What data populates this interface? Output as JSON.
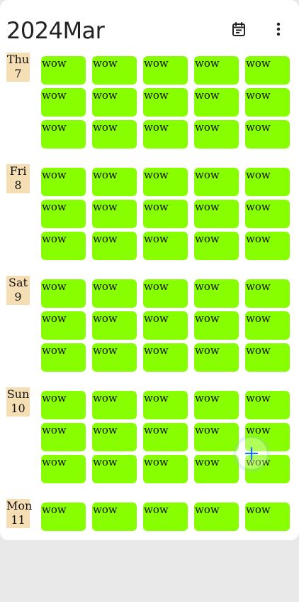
{
  "header": {
    "title": "2024Mar",
    "calendar_icon": "calendar-icon",
    "more_icon": "more-vertical-icon"
  },
  "days": [
    {
      "weekday": "Thu",
      "day": "7",
      "events": [
        "wow",
        "wow",
        "wow",
        "wow",
        "wow",
        "wow",
        "wow",
        "wow",
        "wow",
        "wow",
        "wow",
        "wow",
        "wow",
        "wow",
        "wow"
      ]
    },
    {
      "weekday": "Fri",
      "day": "8",
      "events": [
        "wow",
        "wow",
        "wow",
        "wow",
        "wow",
        "wow",
        "wow",
        "wow",
        "wow",
        "wow",
        "wow",
        "wow",
        "wow",
        "wow",
        "wow"
      ]
    },
    {
      "weekday": "Sat",
      "day": "9",
      "events": [
        "wow",
        "wow",
        "wow",
        "wow",
        "wow",
        "wow",
        "wow",
        "wow",
        "wow",
        "wow",
        "wow",
        "wow",
        "wow",
        "wow",
        "wow"
      ]
    },
    {
      "weekday": "Sun",
      "day": "10",
      "events": [
        "wow",
        "wow",
        "wow",
        "wow",
        "wow",
        "wow",
        "wow",
        "wow",
        "wow",
        "wow",
        "wow",
        "wow",
        "wow",
        "wow",
        "wow"
      ]
    },
    {
      "weekday": "Mon",
      "day": "11",
      "events": [
        "wow",
        "wow",
        "wow",
        "wow",
        "wow"
      ]
    }
  ],
  "fab": {
    "icon": "plus-icon"
  },
  "colors": {
    "event_bg": "#88ff00",
    "date_label_bg": "#f5deb3",
    "fab_plus": "#1a73e8"
  }
}
